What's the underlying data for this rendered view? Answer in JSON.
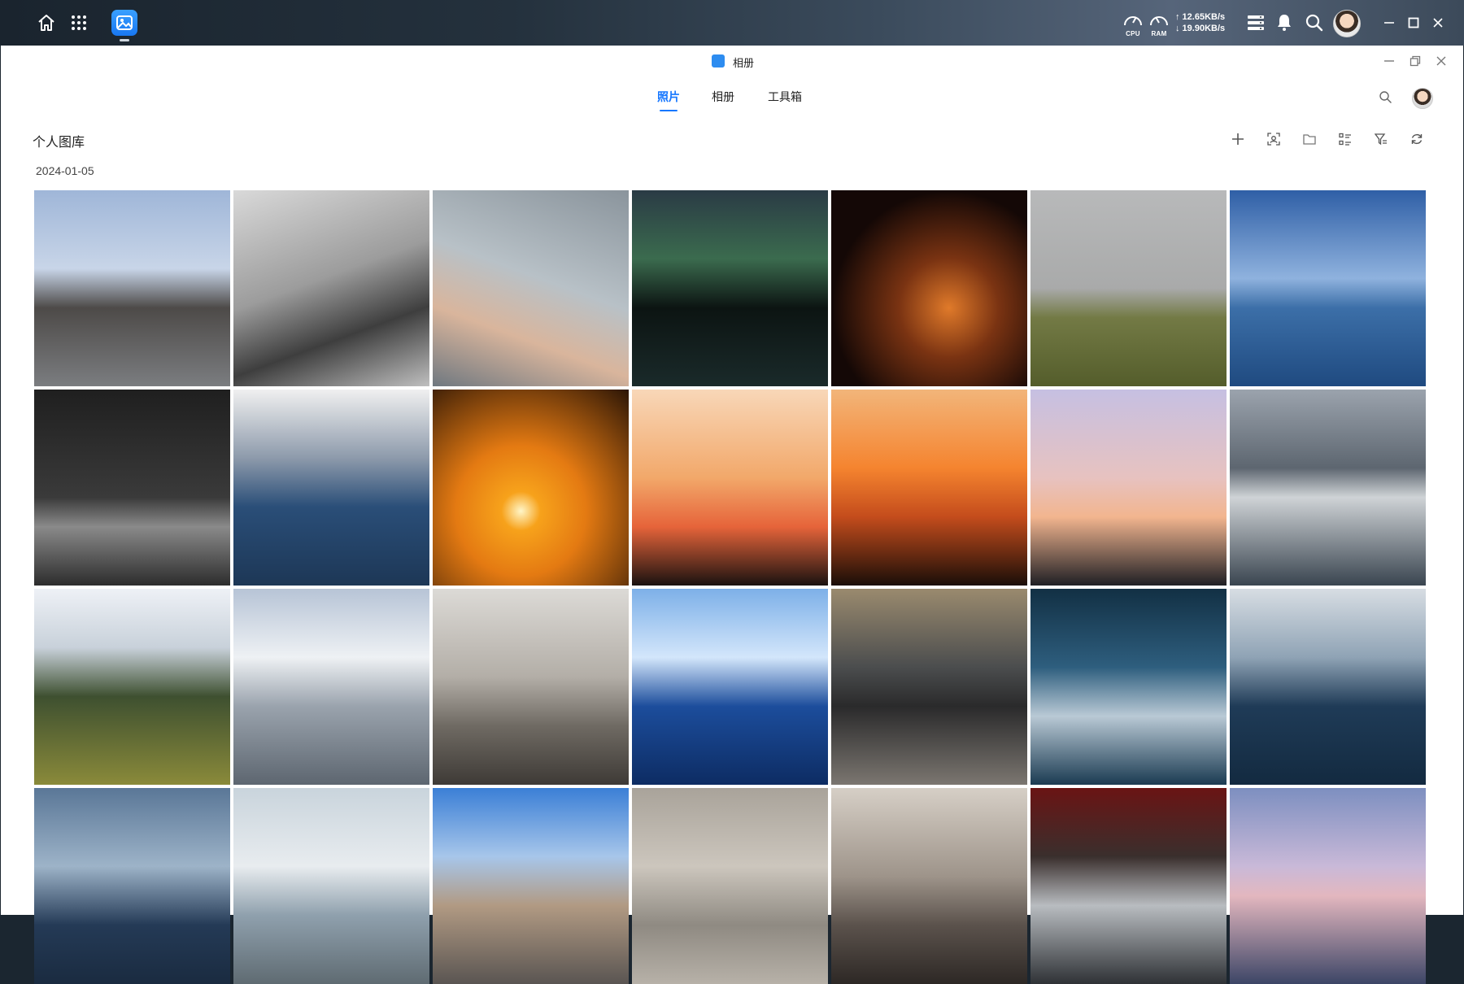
{
  "taskbar": {
    "icons": [
      "home-icon",
      "apps-grid-icon",
      "photo-app-icon"
    ],
    "cpu_label": "CPU",
    "ram_label": "RAM",
    "upload": "↑ 12.65KB/s",
    "download": "↓ 19.90KB/s",
    "right_icons": [
      "widgets-icon",
      "bell-icon",
      "search-icon",
      "user-avatar"
    ]
  },
  "window": {
    "title": "相册",
    "tabs": [
      {
        "label": "照片",
        "active": true
      },
      {
        "label": "相册",
        "active": false
      },
      {
        "label": "工具箱",
        "active": false
      }
    ],
    "library_title": "个人图库",
    "date": "2024-01-05",
    "toolbar_icons": [
      "add-icon",
      "face-scan-icon",
      "folder-icon",
      "list-view-icon",
      "filter-icon",
      "refresh-icon"
    ]
  },
  "colors": {
    "accent": "#1677ff"
  },
  "photos": [
    {
      "name": "mosque-sky",
      "bg": "linear-gradient(180deg,#9fb6d8 0%,#c8d5e8 40%,#4d4a48 60%,#7b7d80 100%)"
    },
    {
      "name": "man-in-suit",
      "bg": "linear-gradient(160deg,#d9d9d9 0%,#9c9c9c 45%,#3e3e3e 70%,#bfbfbf 100%)"
    },
    {
      "name": "hand-flower",
      "bg": "linear-gradient(200deg,#8a949c 0%,#b8c1c7 45%,#d9b59c 70%,#6f7880 100%)"
    },
    {
      "name": "aurora-lake",
      "bg": "linear-gradient(180deg,#2a3b45 0%,#3b6b4e 35%,#0c1412 60%,#1a2a2a 100%)"
    },
    {
      "name": "candles",
      "bg": "radial-gradient(circle at 60% 60%,#e07a2a 0%,#7a3312 30%,#140806 70%)"
    },
    {
      "name": "grass-cliff",
      "bg": "linear-gradient(180deg,#b8b9ba 0%,#a9aaaa 50%,#737a45 65%,#545d2b 100%)"
    },
    {
      "name": "boathouse",
      "bg": "linear-gradient(180deg,#2f5fa6 0%,#8fb2de 45%,#3c6fa8 60%,#1f4a80 100%)"
    },
    {
      "name": "neon-sign",
      "bg": "linear-gradient(180deg,#1f1f1f 0%,#3a3a3a 55%,#8a8a8a 70%,#2d2d2d 100%)"
    },
    {
      "name": "wave-building",
      "bg": "linear-gradient(180deg,#f0f0f0 0%,#8d9aab 35%,#2a4e78 60%,#1d3756 100%)"
    },
    {
      "name": "sunset-tree",
      "bg": "radial-gradient(circle at 45% 62%,#fff6c8 0%,#f7a21b 12%,#e47a12 40%,#2b1506 100%)"
    },
    {
      "name": "dog-person-sunset",
      "bg": "linear-gradient(180deg,#f8d7b8 0%,#f2a86a 45%,#e6643a 70%,#1a1210 100%)"
    },
    {
      "name": "sunset-pair",
      "bg": "linear-gradient(180deg,#f2b57a 0%,#f5842f 40%,#c44c1c 65%,#1a0e08 100%)"
    },
    {
      "name": "silhouette-pastel",
      "bg": "linear-gradient(180deg,#c6c0e2 0%,#e7c2c0 45%,#f2b58f 65%,#1f1f24 100%)"
    },
    {
      "name": "arc-triomphe",
      "bg": "linear-gradient(180deg,#9ba3ad 0%,#5d6670 40%,#cfd3d6 55%,#3a4550 100%)"
    },
    {
      "name": "eucalyptus",
      "bg": "linear-gradient(180deg,#eef1f6 0%,#c8d1da 30%,#3e5030 55%,#8a8a3a 100%)"
    },
    {
      "name": "snowy-pines",
      "bg": "linear-gradient(180deg,#b7c4d6 0%,#eef1f4 35%,#9aa3ad 60%,#5d6670 100%)"
    },
    {
      "name": "baroque-facade",
      "bg": "linear-gradient(180deg,#dcdad6 0%,#b3aea7 45%,#6f6a63 70%,#3e3a36 100%)"
    },
    {
      "name": "blue-cap-man",
      "bg": "linear-gradient(180deg,#7db0e8 0%,#d3e6fb 35%,#1c4d9c 60%,#0d2c63 100%)"
    },
    {
      "name": "scooter-street",
      "bg": "linear-gradient(180deg,#9a8a6e 0%,#4b4d4e 40%,#2a2a2b 60%,#7b7670 100%)"
    },
    {
      "name": "airplane-seats-screen",
      "bg": "linear-gradient(180deg,#123044 0%,#2e5e7e 40%,#b9c9d5 65%,#1b3b52 100%)"
    },
    {
      "name": "airplane-cabin",
      "bg": "linear-gradient(180deg,#d7dde3 0%,#8fa3b5 35%,#1f3b57 60%,#132a40 100%)"
    },
    {
      "name": "airplane-window-seats",
      "bg": "linear-gradient(180deg,#5a7797 0%,#9db3c8 40%,#243a56 70%,#1a2b40 100%)"
    },
    {
      "name": "air-transat-plane",
      "bg": "linear-gradient(180deg,#c9d4dc 0%,#e8ecef 40%,#8fa0ad 65%,#5f6b72 100%)"
    },
    {
      "name": "city-street",
      "bg": "linear-gradient(180deg,#3b7fd6 0%,#a7c6ea 35%,#b19a83 60%,#5a5552 100%)"
    },
    {
      "name": "stone-wall",
      "bg": "linear-gradient(180deg,#a9a39a 0%,#ccc6bd 40%,#8f8a82 70%,#b7b1a8 100%)"
    },
    {
      "name": "umbrella-crowd",
      "bg": "linear-gradient(180deg,#d6cfc6 0%,#9e948a 45%,#5b524c 70%,#2d2825 100%)"
    },
    {
      "name": "snowy-car",
      "bg": "linear-gradient(180deg,#6a1414 0%,#3a2f2d 35%,#b8bcc0 60%,#2f3236 100%)"
    },
    {
      "name": "pink-dusk-bridge",
      "bg": "linear-gradient(180deg,#7d8fc0 0%,#c9b9d8 40%,#e3b7bf 55%,#3c4566 100%)"
    }
  ]
}
